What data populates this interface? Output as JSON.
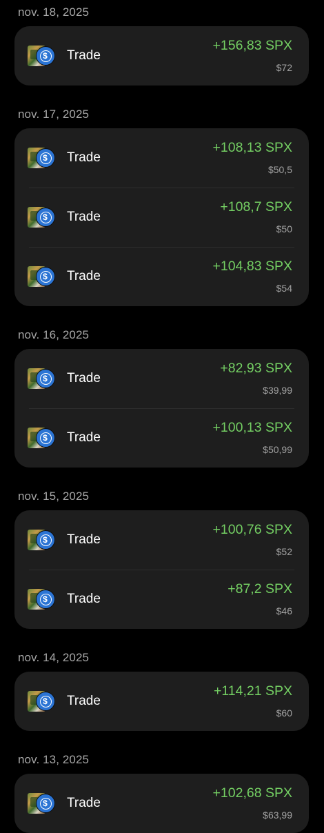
{
  "groups": [
    {
      "date": "nov. 18, 2025",
      "items": [
        {
          "label": "Trade",
          "amount": "+156,83 SPX",
          "usd": "$72"
        }
      ]
    },
    {
      "date": "nov. 17, 2025",
      "items": [
        {
          "label": "Trade",
          "amount": "+108,13 SPX",
          "usd": "$50,5"
        },
        {
          "label": "Trade",
          "amount": "+108,7 SPX",
          "usd": "$50"
        },
        {
          "label": "Trade",
          "amount": "+104,83 SPX",
          "usd": "$54"
        }
      ]
    },
    {
      "date": "nov. 16, 2025",
      "items": [
        {
          "label": "Trade",
          "amount": "+82,93 SPX",
          "usd": "$39,99"
        },
        {
          "label": "Trade",
          "amount": "+100,13 SPX",
          "usd": "$50,99"
        }
      ]
    },
    {
      "date": "nov. 15, 2025",
      "items": [
        {
          "label": "Trade",
          "amount": "+100,76 SPX",
          "usd": "$52"
        },
        {
          "label": "Trade",
          "amount": "+87,2 SPX",
          "usd": "$46"
        }
      ]
    },
    {
      "date": "nov. 14, 2025",
      "items": [
        {
          "label": "Trade",
          "amount": "+114,21 SPX",
          "usd": "$60"
        }
      ]
    },
    {
      "date": "nov. 13, 2025",
      "items": [
        {
          "label": "Trade",
          "amount": "+102,68 SPX",
          "usd": "$63,99"
        }
      ]
    }
  ],
  "icons": {
    "token": "token-pair-icon",
    "usdc": "usdc-icon",
    "usd_symbol": "$"
  },
  "colors": {
    "background": "#000000",
    "card": "#1e1e1e",
    "positive": "#74cf63",
    "muted": "#a7a7a7"
  }
}
